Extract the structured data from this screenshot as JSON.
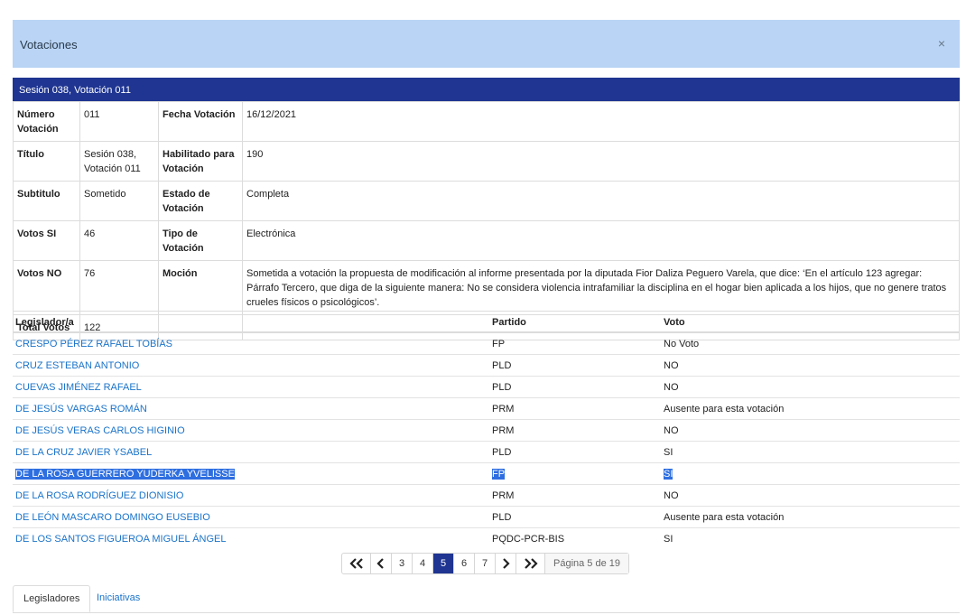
{
  "modal": {
    "title": "Votaciones",
    "close": "×"
  },
  "session": {
    "title": "Sesión 038, Votación 011"
  },
  "info": {
    "numero_label": "Número Votación",
    "numero_value": "011",
    "fecha_label": "Fecha Votación",
    "fecha_value": "16/12/2021",
    "titulo_label": "Título",
    "titulo_value": "Sesión 038, Votación 011",
    "habilitado_label": "Habilitado para Votación",
    "habilitado_value": "190",
    "subtitulo_label": "Subtitulo",
    "subtitulo_value": "Sometido",
    "estado_label": "Estado de Votación",
    "estado_value": "Completa",
    "votos_si_label": "Votos SI",
    "votos_si_value": "46",
    "tipo_label": "Tipo de Votación",
    "tipo_value": "Electrónica",
    "votos_no_label": "Votos NO",
    "votos_no_value": "76",
    "mocion_label": "Moción",
    "mocion_value": "Sometida a votación la propuesta de modificación al informe presentada por la diputada Fior Daliza Peguero Varela, que dice: ‘En el artículo 123 agregar: Párrafo Tercero, que diga de la siguiente manera: No se considera violencia intrafamiliar la disciplina en el hogar bien aplicada a los hijos, que no genere tratos crueles físicos o psicológicos’.",
    "total_label": "Total Votos",
    "total_value": "122"
  },
  "votes": {
    "headers": {
      "legislador": "Legislador/a",
      "partido": "Partido",
      "voto": "Voto"
    },
    "rows": [
      {
        "name": "CRESPO PÉREZ RAFAEL TOBÍAS",
        "party": "FP",
        "vote": "No Voto"
      },
      {
        "name": "CRUZ ESTEBAN ANTONIO",
        "party": "PLD",
        "vote": "NO"
      },
      {
        "name": "CUEVAS JIMÉNEZ RAFAEL",
        "party": "PLD",
        "vote": "NO"
      },
      {
        "name": "DE JESÚS VARGAS ROMÁN",
        "party": "PRM",
        "vote": "Ausente para esta votación"
      },
      {
        "name": "DE JESÚS VERAS CARLOS HIGINIO",
        "party": "PRM",
        "vote": "NO"
      },
      {
        "name": "DE LA CRUZ JAVIER YSABEL",
        "party": "PLD",
        "vote": "SI"
      },
      {
        "name": "DE LA ROSA GUERRERO YUDERKA YVELISSE",
        "party": "FP",
        "vote": "SI"
      },
      {
        "name": "DE LA ROSA RODRÍGUEZ DIONISIO",
        "party": "PRM",
        "vote": "NO"
      },
      {
        "name": "DE LEÓN MASCARO DOMINGO EUSEBIO",
        "party": "PLD",
        "vote": "Ausente para esta votación"
      },
      {
        "name": "DE LOS SANTOS FIGUEROA MIGUEL ÁNGEL",
        "party": "PQDC-PCR-BIS",
        "vote": "SI"
      }
    ]
  },
  "pager": {
    "pages": [
      "3",
      "4",
      "5",
      "6",
      "7"
    ],
    "current": "5",
    "info": "Página 5 de 19"
  },
  "tabs": {
    "legisladores": "Legisladores",
    "iniciativas": "Iniciativas"
  },
  "colors": {
    "header_bg": "#b9d4f5",
    "session_bar": "#1f3591",
    "link": "#1a73c9",
    "selection": "#2d6ee0"
  }
}
